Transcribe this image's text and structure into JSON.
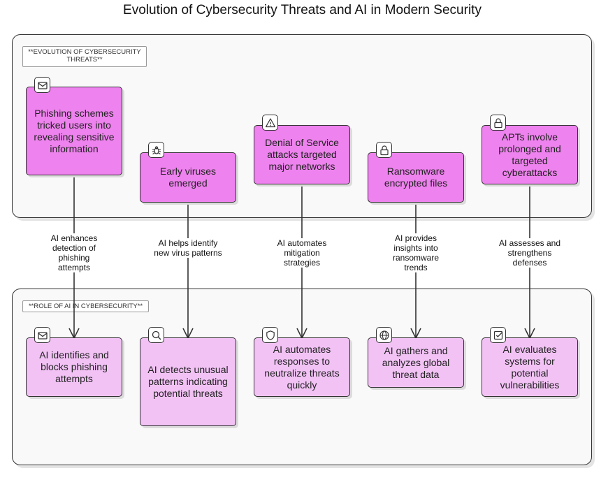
{
  "title": "Evolution of Cybersecurity Threats and AI in Modern Security",
  "groups": {
    "threats": {
      "label": "**EVOLUTION OF CYBERSECURITY THREATS**"
    },
    "ai_role": {
      "label": "**ROLE OF AI IN CYBERSECURITY**"
    }
  },
  "threat_nodes": [
    {
      "icon": "mail-icon",
      "text": "Phishing schemes tricked users into revealing sensitive information"
    },
    {
      "icon": "bug-icon",
      "text": "Early viruses emerged"
    },
    {
      "icon": "warning-icon",
      "text": "Denial of Service attacks targeted major networks"
    },
    {
      "icon": "lock-icon",
      "text": "Ransomware encrypted files"
    },
    {
      "icon": "lock-icon",
      "text": "APTs involve prolonged and targeted cyberattacks"
    }
  ],
  "ai_nodes": [
    {
      "icon": "mail-icon",
      "text": "AI identifies and blocks phishing attempts"
    },
    {
      "icon": "search-icon",
      "text": "AI detects unusual patterns indicating potential threats"
    },
    {
      "icon": "shield-icon",
      "text": "AI automates responses to neutralize threats quickly"
    },
    {
      "icon": "globe-icon",
      "text": "AI gathers and analyzes global threat data"
    },
    {
      "icon": "check-square-icon",
      "text": "AI evaluates systems for potential vulnerabilities"
    }
  ],
  "edges": [
    {
      "label": "AI enhances detection of phishing attempts"
    },
    {
      "label": "AI helps identify new virus patterns"
    },
    {
      "label": "AI automates mitigation strategies"
    },
    {
      "label": "AI provides insights into ransomware trends"
    },
    {
      "label": "AI assesses and strengthens defenses"
    }
  ]
}
